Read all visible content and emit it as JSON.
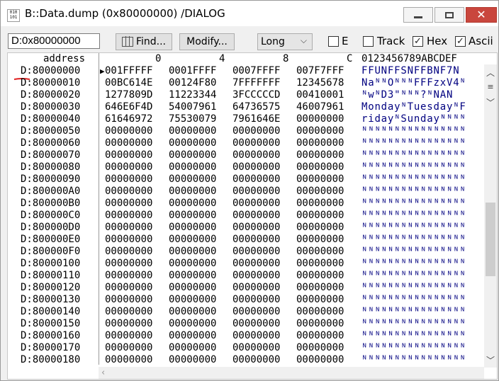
{
  "window": {
    "title": "B::Data.dump (0x80000000) /DIALOG",
    "app_icon_text": "010\n101"
  },
  "toolbar": {
    "address_value": "D:0x80000000",
    "find_label": "Find...",
    "modify_label": "Modify...",
    "format_selected": "Long",
    "checkboxes": [
      {
        "label": "E",
        "checked": false
      },
      {
        "label": "Track",
        "checked": false
      },
      {
        "label": "Hex",
        "checked": true
      },
      {
        "label": "Ascii",
        "checked": true
      }
    ]
  },
  "columns": {
    "address": "address",
    "c0": "0",
    "c4": "4",
    "c8": "8",
    "cC": "C",
    "ascii": "0123456789ABCDEF"
  },
  "rows": [
    {
      "addr": "D:80000000",
      "w": [
        "001FFFFF",
        "0001FFFF",
        "0007FFFF",
        "007F7FFF"
      ],
      "ascii": "FFUNFFSNFFBNF7N"
    },
    {
      "addr": "D:80000010",
      "w": [
        "00BC614E",
        "00124F80",
        "7FFFFFFF",
        "12345678"
      ],
      "ascii": "NaᴺᴺOᴺᴺᴺFFFzxV4ᴺ"
    },
    {
      "addr": "D:80000020",
      "w": [
        "1277809D",
        "11223344",
        "3FCCCCCD",
        "00410001"
      ],
      "ascii": "ᴺwᴺD3\"ᴺᴺᴺ?ᴺNAN"
    },
    {
      "addr": "D:80000030",
      "w": [
        "646E6F4D",
        "54007961",
        "64736575",
        "46007961"
      ],
      "ascii": "MondayᴺTuesdayᴺF"
    },
    {
      "addr": "D:80000040",
      "w": [
        "61646972",
        "75530079",
        "7961646E",
        "00000000"
      ],
      "ascii": "ridayᴺSundayᴺᴺᴺᴺ"
    },
    {
      "addr": "D:80000050",
      "w": [
        "00000000",
        "00000000",
        "00000000",
        "00000000"
      ],
      "ascii": "ᴺᴺᴺᴺᴺᴺᴺᴺᴺᴺᴺᴺᴺᴺᴺᴺ"
    },
    {
      "addr": "D:80000060",
      "w": [
        "00000000",
        "00000000",
        "00000000",
        "00000000"
      ],
      "ascii": "ᴺᴺᴺᴺᴺᴺᴺᴺᴺᴺᴺᴺᴺᴺᴺᴺ"
    },
    {
      "addr": "D:80000070",
      "w": [
        "00000000",
        "00000000",
        "00000000",
        "00000000"
      ],
      "ascii": "ᴺᴺᴺᴺᴺᴺᴺᴺᴺᴺᴺᴺᴺᴺᴺᴺ"
    },
    {
      "addr": "D:80000080",
      "w": [
        "00000000",
        "00000000",
        "00000000",
        "00000000"
      ],
      "ascii": "ᴺᴺᴺᴺᴺᴺᴺᴺᴺᴺᴺᴺᴺᴺᴺᴺ"
    },
    {
      "addr": "D:80000090",
      "w": [
        "00000000",
        "00000000",
        "00000000",
        "00000000"
      ],
      "ascii": "ᴺᴺᴺᴺᴺᴺᴺᴺᴺᴺᴺᴺᴺᴺᴺᴺ"
    },
    {
      "addr": "D:800000A0",
      "w": [
        "00000000",
        "00000000",
        "00000000",
        "00000000"
      ],
      "ascii": "ᴺᴺᴺᴺᴺᴺᴺᴺᴺᴺᴺᴺᴺᴺᴺᴺ"
    },
    {
      "addr": "D:800000B0",
      "w": [
        "00000000",
        "00000000",
        "00000000",
        "00000000"
      ],
      "ascii": "ᴺᴺᴺᴺᴺᴺᴺᴺᴺᴺᴺᴺᴺᴺᴺᴺ"
    },
    {
      "addr": "D:800000C0",
      "w": [
        "00000000",
        "00000000",
        "00000000",
        "00000000"
      ],
      "ascii": "ᴺᴺᴺᴺᴺᴺᴺᴺᴺᴺᴺᴺᴺᴺᴺᴺ"
    },
    {
      "addr": "D:800000D0",
      "w": [
        "00000000",
        "00000000",
        "00000000",
        "00000000"
      ],
      "ascii": "ᴺᴺᴺᴺᴺᴺᴺᴺᴺᴺᴺᴺᴺᴺᴺᴺ"
    },
    {
      "addr": "D:800000E0",
      "w": [
        "00000000",
        "00000000",
        "00000000",
        "00000000"
      ],
      "ascii": "ᴺᴺᴺᴺᴺᴺᴺᴺᴺᴺᴺᴺᴺᴺᴺᴺ"
    },
    {
      "addr": "D:800000F0",
      "w": [
        "00000000",
        "00000000",
        "00000000",
        "00000000"
      ],
      "ascii": "ᴺᴺᴺᴺᴺᴺᴺᴺᴺᴺᴺᴺᴺᴺᴺᴺ"
    },
    {
      "addr": "D:80000100",
      "w": [
        "00000000",
        "00000000",
        "00000000",
        "00000000"
      ],
      "ascii": "ᴺᴺᴺᴺᴺᴺᴺᴺᴺᴺᴺᴺᴺᴺᴺᴺ"
    },
    {
      "addr": "D:80000110",
      "w": [
        "00000000",
        "00000000",
        "00000000",
        "00000000"
      ],
      "ascii": "ᴺᴺᴺᴺᴺᴺᴺᴺᴺᴺᴺᴺᴺᴺᴺᴺ"
    },
    {
      "addr": "D:80000120",
      "w": [
        "00000000",
        "00000000",
        "00000000",
        "00000000"
      ],
      "ascii": "ᴺᴺᴺᴺᴺᴺᴺᴺᴺᴺᴺᴺᴺᴺᴺᴺ"
    },
    {
      "addr": "D:80000130",
      "w": [
        "00000000",
        "00000000",
        "00000000",
        "00000000"
      ],
      "ascii": "ᴺᴺᴺᴺᴺᴺᴺᴺᴺᴺᴺᴺᴺᴺᴺᴺ"
    },
    {
      "addr": "D:80000140",
      "w": [
        "00000000",
        "00000000",
        "00000000",
        "00000000"
      ],
      "ascii": "ᴺᴺᴺᴺᴺᴺᴺᴺᴺᴺᴺᴺᴺᴺᴺᴺ"
    },
    {
      "addr": "D:80000150",
      "w": [
        "00000000",
        "00000000",
        "00000000",
        "00000000"
      ],
      "ascii": "ᴺᴺᴺᴺᴺᴺᴺᴺᴺᴺᴺᴺᴺᴺᴺᴺ"
    },
    {
      "addr": "D:80000160",
      "w": [
        "00000000",
        "00000000",
        "00000000",
        "00000000"
      ],
      "ascii": "ᴺᴺᴺᴺᴺᴺᴺᴺᴺᴺᴺᴺᴺᴺᴺᴺ"
    },
    {
      "addr": "D:80000170",
      "w": [
        "00000000",
        "00000000",
        "00000000",
        "00000000"
      ],
      "ascii": "ᴺᴺᴺᴺᴺᴺᴺᴺᴺᴺᴺᴺᴺᴺᴺᴺ"
    },
    {
      "addr": "D:80000180",
      "w": [
        "00000000",
        "00000000",
        "00000000",
        "00000000"
      ],
      "ascii": "ᴺᴺᴺᴺᴺᴺᴺᴺᴺᴺᴺᴺᴺᴺᴺᴺ"
    }
  ],
  "icons": {
    "app": "app-icon",
    "minimize": "minimize-icon",
    "maximize": "maximize-icon",
    "close": "close-icon",
    "find": "binoculars-icon",
    "dropdown": "chevron-down-icon",
    "cursor": "triangle-right-icon",
    "scroll_up": "chevron-up-icon",
    "scroll_down": "chevron-down-icon",
    "scroll_left": "chevron-left-icon"
  },
  "colors": {
    "ascii_text": "#000080",
    "close_button": "#c9463d",
    "annotation_mark": "#e02020"
  }
}
